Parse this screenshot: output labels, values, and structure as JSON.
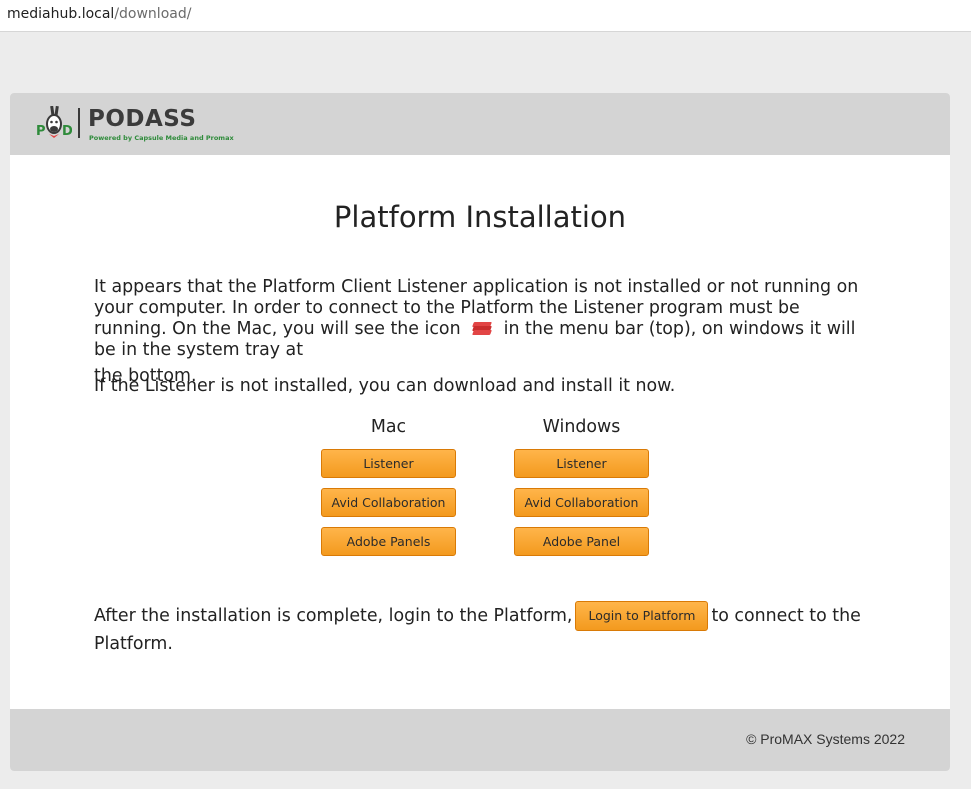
{
  "browser": {
    "url_host": "mediahub.local",
    "url_path": "/download/"
  },
  "header": {
    "logo_name": "PODASS",
    "logo_tagline": "Powered by Capsule Media and Promax",
    "logo_mark": "POD"
  },
  "main": {
    "title": "Platform Installation",
    "intro_text_before_icon": "It appears that the Platform Client Listener application is not installed or not running on your computer. In order to connect to the Platform the Listener program must be running. On the Mac, you will see the icon",
    "intro_text_after_icon": "in the menu bar (top), on windows it will be in the system tray at",
    "intro_last_line": "the bottom.",
    "listener_icon": "stack-icon",
    "download_prompt": "If the Listener is not installed, you can download and install it now.",
    "columns": {
      "mac": {
        "heading": "Mac",
        "buttons": [
          "Listener",
          "Avid Collaboration",
          "Adobe Panels"
        ]
      },
      "windows": {
        "heading": "Windows",
        "buttons": [
          "Listener",
          "Avid Collaboration",
          "Adobe Panel"
        ]
      }
    },
    "after_text_before": "After the installation is complete, login to the Platform,",
    "login_button": "Login to Platform",
    "after_text_after": "to connect to the Platform."
  },
  "footer": {
    "copyright": "© ProMAX Systems 2022"
  },
  "colors": {
    "button_orange": "#f39a1e",
    "header_gray": "#d4d4d4",
    "brand_green": "#2e8b3a"
  }
}
